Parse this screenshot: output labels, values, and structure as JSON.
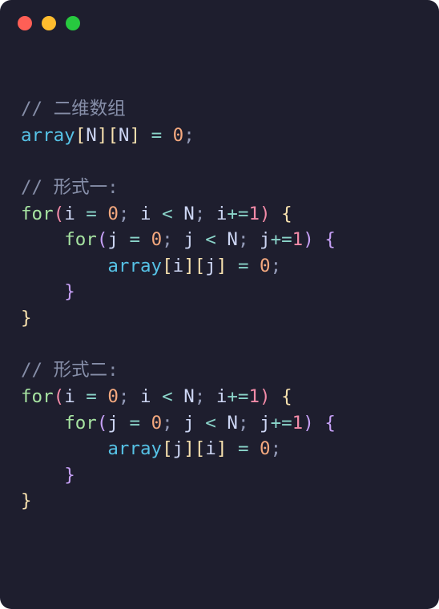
{
  "code": {
    "comment1": "// 二维数组",
    "line_decl": {
      "name": "array",
      "dim1": "N",
      "dim2": "N",
      "assign": "=",
      "val": "0",
      "semi": ";"
    },
    "comment2": "// 形式一:",
    "for": "for",
    "i": "i",
    "j": "j",
    "N": "N",
    "eq": "=",
    "zero": "0",
    "lt": "<",
    "pluseq": "+=",
    "one": "1",
    "semi": ";",
    "open_paren": "(",
    "close_paren": ")",
    "open_brace": "{",
    "close_brace": "}",
    "open_bracket": "[",
    "close_bracket": "]",
    "comment3": "// 形式二:",
    "array": "array",
    "form1_inner_idx1": "i",
    "form1_inner_idx2": "j",
    "form2_inner_idx1": "j",
    "form2_inner_idx2": "i"
  }
}
